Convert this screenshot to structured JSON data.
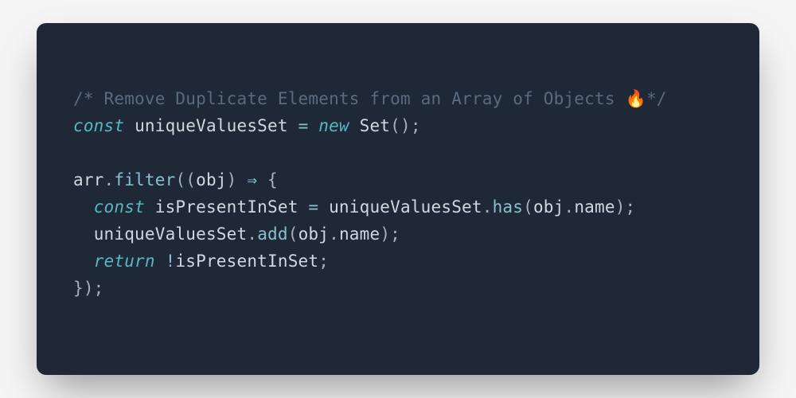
{
  "code": {
    "line1": {
      "comment_open": "/* ",
      "comment_text": "Remove Duplicate Elements from an Array of Objects ",
      "emoji": "🔥",
      "comment_close": "*/"
    },
    "line2": {
      "kw_const": "const",
      "ident": "uniqueValuesSet",
      "eq": "=",
      "kw_new": "new",
      "cls": "Set",
      "parens": "();"
    },
    "line3": "",
    "line4": {
      "ident_arr": "arr",
      "dot1": ".",
      "method_filter": "filter",
      "open": "((",
      "param": "obj",
      "close": ")",
      "arrow": "⇒",
      "brace": "{"
    },
    "line5": {
      "indent": "  ",
      "kw_const": "const",
      "ident": "isPresentInSet",
      "eq": "=",
      "uvs": "uniqueValuesSet",
      "dot": ".",
      "method": "has",
      "open": "(",
      "obj": "obj",
      "dot2": ".",
      "prop": "name",
      "close": ");"
    },
    "line6": {
      "indent": "  ",
      "uvs": "uniqueValuesSet",
      "dot": ".",
      "method": "add",
      "open": "(",
      "obj": "obj",
      "dot2": ".",
      "prop": "name",
      "close": ");"
    },
    "line7": {
      "indent": "  ",
      "kw_return": "return",
      "bang": "!",
      "ident": "isPresentInSet",
      "semi": ";"
    },
    "line8": {
      "close": "});"
    }
  },
  "colors": {
    "bg": "#1e2836",
    "page_bg": "#f5f5f5",
    "comment": "#5b6b7f",
    "keyword": "#58b7c2",
    "identifier": "#d2d8df",
    "method": "#88c0d0"
  }
}
